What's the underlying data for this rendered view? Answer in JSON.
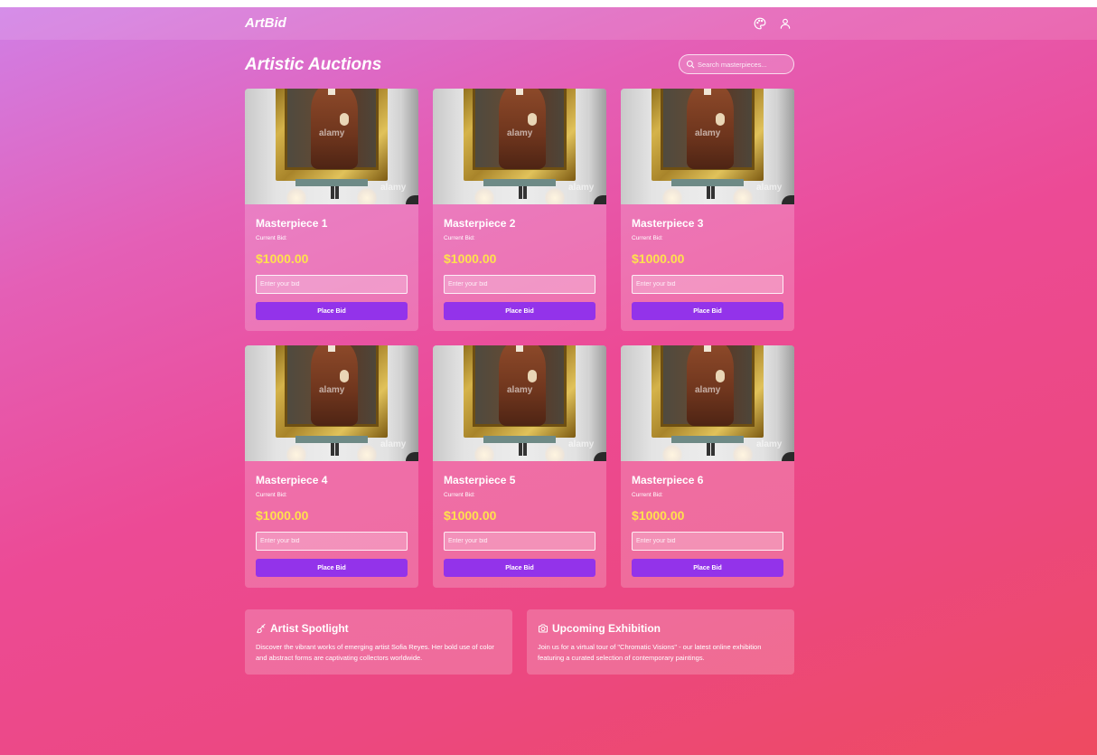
{
  "app": {
    "brand": "ArtBid",
    "page_title": "Artistic Auctions"
  },
  "search": {
    "placeholder": "Search masterpieces..."
  },
  "nav_icons": [
    "palette-icon",
    "user-icon"
  ],
  "auction_cards": [
    {
      "title": "Masterpiece 1",
      "bid_label": "Current Bid:",
      "bid_value": "$1000.00",
      "input_placeholder": "Enter your bid",
      "button_label": "Place Bid",
      "image_watermark": "alamy"
    },
    {
      "title": "Masterpiece 2",
      "bid_label": "Current Bid:",
      "bid_value": "$1000.00",
      "input_placeholder": "Enter your bid",
      "button_label": "Place Bid",
      "image_watermark": "alamy"
    },
    {
      "title": "Masterpiece 3",
      "bid_label": "Current Bid:",
      "bid_value": "$1000.00",
      "input_placeholder": "Enter your bid",
      "button_label": "Place Bid",
      "image_watermark": "alamy"
    },
    {
      "title": "Masterpiece 4",
      "bid_label": "Current Bid:",
      "bid_value": "$1000.00",
      "input_placeholder": "Enter your bid",
      "button_label": "Place Bid",
      "image_watermark": "alamy"
    },
    {
      "title": "Masterpiece 5",
      "bid_label": "Current Bid:",
      "bid_value": "$1000.00",
      "input_placeholder": "Enter your bid",
      "button_label": "Place Bid",
      "image_watermark": "alamy"
    },
    {
      "title": "Masterpiece 6",
      "bid_label": "Current Bid:",
      "bid_value": "$1000.00",
      "input_placeholder": "Enter your bid",
      "button_label": "Place Bid",
      "image_watermark": "alamy"
    }
  ],
  "info": {
    "spotlight": {
      "icon": "brush-icon",
      "title": "Artist Spotlight",
      "text": "Discover the vibrant works of emerging artist Sofia Reyes. Her bold use of color and abstract forms are captivating collectors worldwide."
    },
    "exhibition": {
      "icon": "camera-icon",
      "title": "Upcoming Exhibition",
      "text": "Join us for a virtual tour of \"Chromatic Visions\" - our latest online exhibition featuring a curated selection of contemporary paintings."
    }
  },
  "colors": {
    "gradient_start": "#d07fe6",
    "gradient_mid": "#ec4a95",
    "gradient_end": "#ee4a60",
    "bid_value": "#ffe14d",
    "button": "#9333ea"
  }
}
